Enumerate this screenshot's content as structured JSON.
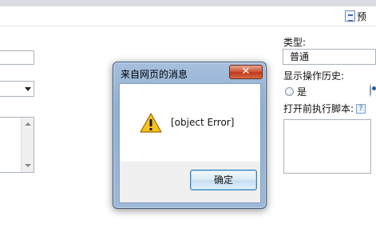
{
  "toolbar": {
    "preview_label": "预"
  },
  "right_panel": {
    "type_label": "类型:",
    "type_value": "普通",
    "history_label": "显示操作历史:",
    "history_yes_label": "是",
    "script_label": "打开前执行脚本:"
  },
  "dialog": {
    "title": "来自网页的消息",
    "close_symbol": "✕",
    "message": "[object Error]",
    "ok_label": "确定"
  },
  "icons": {
    "warning": "warning-icon",
    "close": "close-icon",
    "toolbar": "preview-icon",
    "help": "script-help-icon"
  },
  "colors": {
    "dialog_frame": "#9cb9d8",
    "close_button": "#c0391b",
    "warning_yellow": "#f6c21c"
  }
}
